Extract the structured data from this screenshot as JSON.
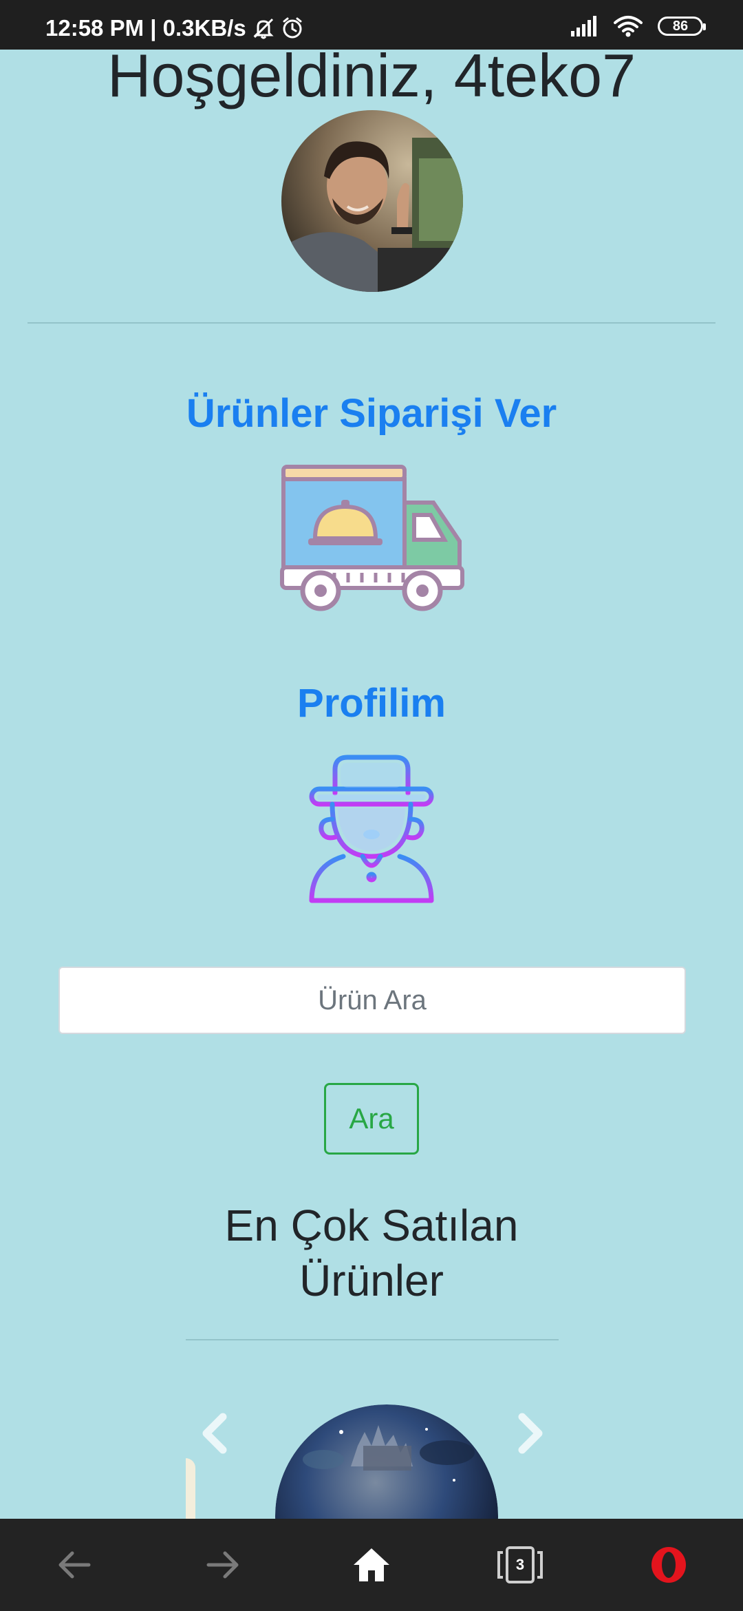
{
  "status_bar": {
    "time_network": "12:58 PM | 0.3KB/s",
    "battery": "86"
  },
  "header": {
    "welcome": "Hoşgeldiniz, 4teko7"
  },
  "sections": {
    "orders_title": "Ürünler Siparişi Ver",
    "profile_title": "Profilim"
  },
  "search": {
    "placeholder": "Ürün Ara",
    "value": "",
    "button_label": "Ara"
  },
  "bestsellers": {
    "title": "En Çok Satılan Ürünler"
  },
  "nav_bar": {
    "tabs_count": "3",
    "icons": [
      "back-icon",
      "forward-icon",
      "home-icon",
      "tabs-icon",
      "opera-icon"
    ]
  },
  "colors": {
    "page_background": "#b0dfe5",
    "link_blue": "#1a7ff0",
    "button_green": "#28a745",
    "bar_background": "#232323"
  }
}
